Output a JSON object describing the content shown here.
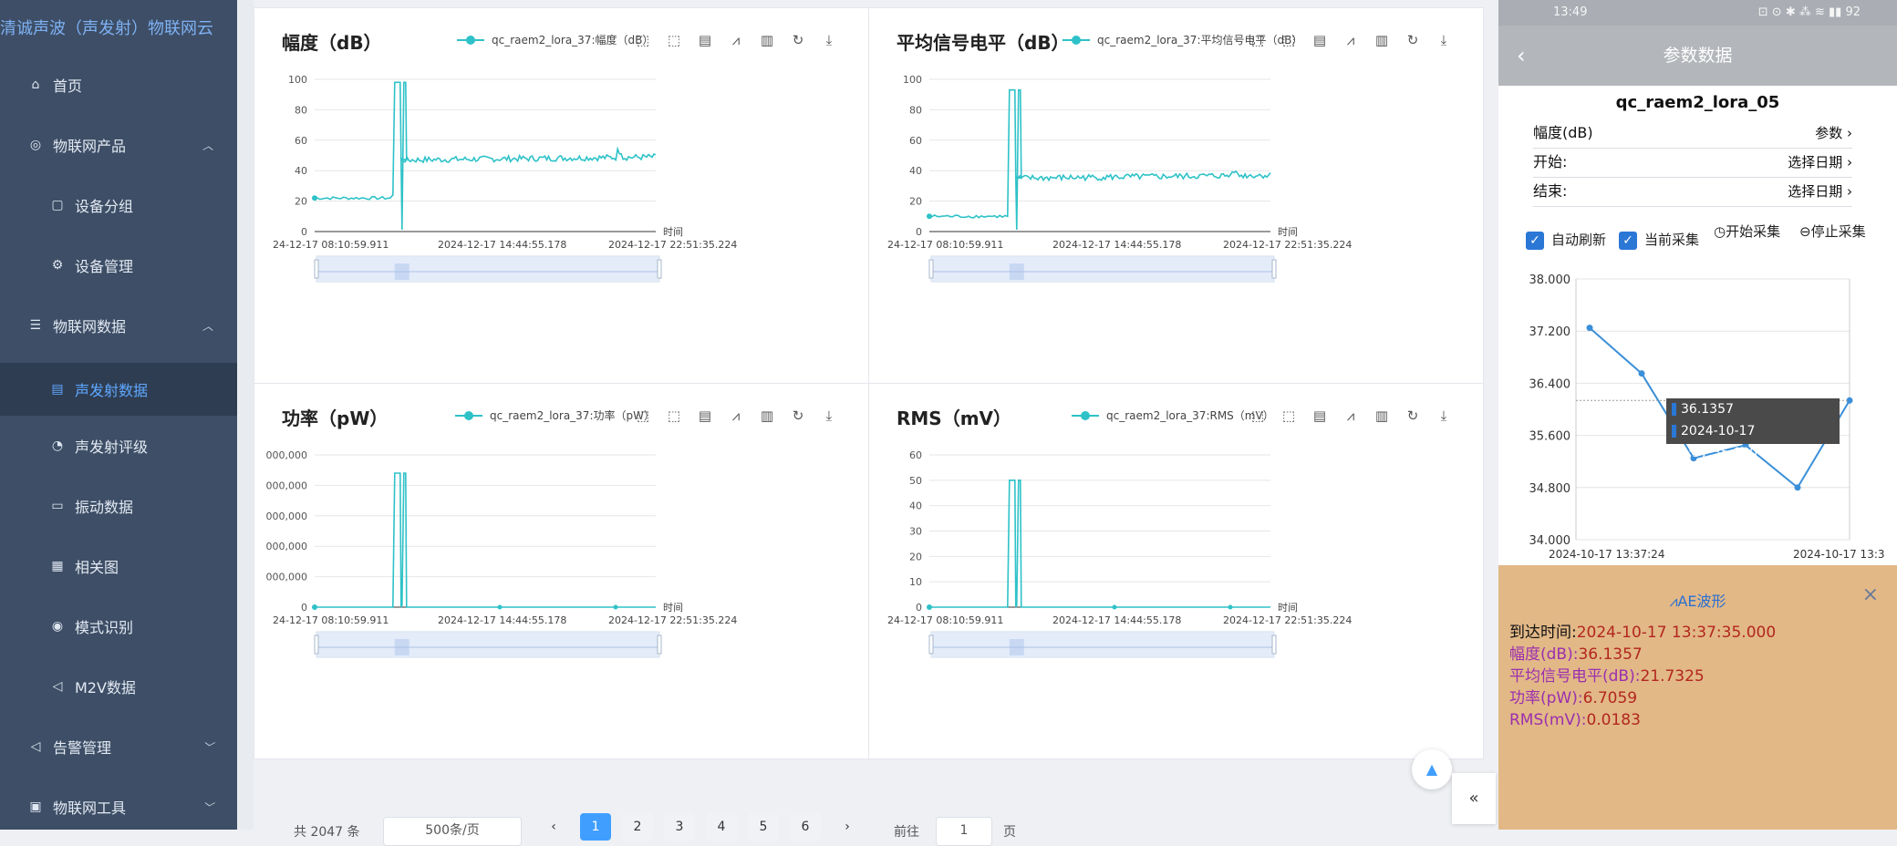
{
  "sidebar": {
    "brand": "清诚声波（声发射）物联网云",
    "items": [
      {
        "label": "首页",
        "icon": "home-icon"
      },
      {
        "label": "物联网产品",
        "icon": "product-icon"
      },
      {
        "label": "设备分组",
        "icon": "group-icon"
      },
      {
        "label": "设备管理",
        "icon": "device-icon"
      },
      {
        "label": "物联网数据",
        "icon": "data-icon"
      },
      {
        "label": "声发射数据",
        "icon": "ae-data-icon"
      },
      {
        "label": "声发射评级",
        "icon": "rating-icon"
      },
      {
        "label": "振动数据",
        "icon": "folder-icon"
      },
      {
        "label": "相关图",
        "icon": "chart-icon"
      },
      {
        "label": "模式识别",
        "icon": "pattern-icon"
      },
      {
        "label": "M2V数据",
        "icon": "m2v-icon"
      },
      {
        "label": "告警管理",
        "icon": "alarm-icon"
      },
      {
        "label": "物联网工具",
        "icon": "tools-icon"
      }
    ]
  },
  "charts": [
    {
      "title": "幅度（dB）",
      "legend": "qc_raem2_lora_37:幅度（dB）",
      "xaxis_name": "时间",
      "yticks": [
        "100",
        "80",
        "60",
        "40",
        "20",
        "0"
      ],
      "xticks": [
        "24-12-17 08:10:59.911",
        "2024-12-17 14:44:55.178",
        "2024-12-17 22:51:35.224"
      ]
    },
    {
      "title": "平均信号电平（dB）",
      "legend": "qc_raem2_lora_37:平均信号电平（dB）",
      "xaxis_name": "时间",
      "yticks": [
        "100",
        "80",
        "60",
        "40",
        "20",
        "0"
      ],
      "xticks": [
        "24-12-17 08:10:59.911",
        "2024-12-17 14:44:55.178",
        "2024-12-17 22:51:35.224"
      ]
    },
    {
      "title": "功率（pW）",
      "legend": "qc_raem2_lora_37:功率（pW）",
      "xaxis_name": "时间",
      "yticks": [
        "000,000",
        "000,000",
        "000,000",
        "000,000",
        "000,000",
        "0"
      ],
      "xticks": [
        "24-12-17 08:10:59.911",
        "2024-12-17 14:44:55.178",
        "2024-12-17 22:51:35.224"
      ]
    },
    {
      "title": "RMS（mV）",
      "legend": "qc_raem2_lora_37:RMS（mV）",
      "xaxis_name": "时间",
      "yticks": [
        "60",
        "50",
        "40",
        "30",
        "20",
        "10",
        "0"
      ],
      "xticks": [
        "24-12-17 08:10:59.911",
        "2024-12-17 14:44:55.178",
        "2024-12-17 22:51:35.224"
      ]
    }
  ],
  "chart_data": [
    {
      "type": "line",
      "title": "幅度（dB）",
      "xlabel": "时间",
      "ylim": [
        0,
        100
      ],
      "series": [
        {
          "name": "qc_raem2_lora_37:幅度（dB）",
          "x": [
            "2024-12-17 08:10:59.911",
            "2024-12-17 11:33:00",
            "2024-12-17 11:35:00",
            "2024-12-17 11:50:00",
            "2024-12-17 11:55:00",
            "2024-12-17 14:44:55.178",
            "2024-12-17 18:30:00",
            "2024-12-17 22:51:35.224"
          ],
          "y": [
            22,
            24,
            98,
            22,
            47,
            46,
            48,
            47
          ]
        }
      ]
    },
    {
      "type": "line",
      "title": "平均信号电平（dB）",
      "xlabel": "时间",
      "ylim": [
        0,
        100
      ],
      "series": [
        {
          "name": "qc_raem2_lora_37:平均信号电平（dB）",
          "x": [
            "2024-12-17 08:10:59.911",
            "2024-12-17 11:33:00",
            "2024-12-17 11:35:00",
            "2024-12-17 11:50:00",
            "2024-12-17 11:55:00",
            "2024-12-17 14:44:55.178",
            "2024-12-17 18:30:00",
            "2024-12-17 22:51:35.224"
          ],
          "y": [
            10,
            10,
            93,
            10,
            35,
            34,
            36,
            36
          ]
        }
      ]
    },
    {
      "type": "line",
      "title": "功率（pW）",
      "xlabel": "时间",
      "series": [
        {
          "name": "qc_raem2_lora_37:功率（pW）",
          "x": [
            "2024-12-17 08:10:59.911",
            "2024-12-17 11:33:00",
            "2024-12-17 11:35:00",
            "2024-12-17 11:50:00",
            "2024-12-17 11:55:00",
            "2024-12-17 22:51:35.224"
          ],
          "y": [
            0,
            0,
            0.7,
            0,
            0,
            0
          ]
        }
      ]
    },
    {
      "type": "line",
      "title": "RMS（mV）",
      "xlabel": "时间",
      "ylim": [
        0,
        60
      ],
      "series": [
        {
          "name": "qc_raem2_lora_37:RMS（mV）",
          "x": [
            "2024-12-17 08:10:59.911",
            "2024-12-17 11:33:00",
            "2024-12-17 11:35:00",
            "2024-12-17 11:50:00",
            "2024-12-17 11:55:00",
            "2024-12-17 22:51:35.224"
          ],
          "y": [
            0,
            0,
            50,
            0,
            0,
            0
          ]
        }
      ]
    },
    {
      "type": "line",
      "title": "",
      "ylim": [
        34.0,
        38.0
      ],
      "x": [
        "2024-10-17 13:37:24",
        "",
        "",
        "",
        "",
        "2024-10-17 13:37:35.000"
      ],
      "series": [
        {
          "values": [
            37.25,
            36.55,
            35.25,
            35.45,
            34.8,
            36.1357
          ]
        }
      ]
    }
  ],
  "pagination": {
    "total": "共 2047 条",
    "page_size": "500条/页",
    "pages": [
      "1",
      "2",
      "3",
      "4",
      "5",
      "6"
    ],
    "prev": "‹",
    "next": "›",
    "goto_label": "前往",
    "goto_value": "1",
    "page_unit": "页"
  },
  "phone": {
    "time": "13:49",
    "status_icons": "⊡ ⊙ ✱ ⁂ ≋ ▮▮ 92",
    "nav_title": "参数数据",
    "device": "qc_raem2_lora_05",
    "rows": [
      {
        "label": "幅度(dB)",
        "value": "参数"
      },
      {
        "label": "开始:",
        "value": "选择日期"
      },
      {
        "label": "结束:",
        "value": "选择日期"
      }
    ],
    "options": {
      "auto_refresh": "自动刷新",
      "current_collect": "当前采集",
      "start_collect": "开始采集",
      "stop_collect": "停止采集"
    },
    "yticks": [
      "38.000",
      "37.200",
      "36.400",
      "35.600",
      "34.800",
      "34.000"
    ],
    "xticks": [
      "2024-10-17 13:37:24",
      "2024-10-17 13:3"
    ],
    "tooltip": {
      "value": "36.1357",
      "time": "2024-10-17 13:37:35.000"
    }
  },
  "ae": {
    "title": "AE波形",
    "arrival": {
      "label": "到达时间:",
      "value": "2024-10-17 13:37:35.000"
    },
    "lines": [
      {
        "label": "幅度(dB):",
        "value": "36.1357"
      },
      {
        "label": "平均信号电平(dB):",
        "value": "21.7325"
      },
      {
        "label": "功率(pW):",
        "value": "6.7059"
      },
      {
        "label": "RMS(mV):",
        "value": "0.0183"
      }
    ]
  },
  "colors": {
    "series": "#2ec2c8",
    "sidebar": "#3d4e66",
    "active": "#5ea8ff",
    "accent": "#409eff",
    "ae_bg": "#e2b887",
    "ae_label": "#9b2fae",
    "ae_value": "#b3261e"
  }
}
